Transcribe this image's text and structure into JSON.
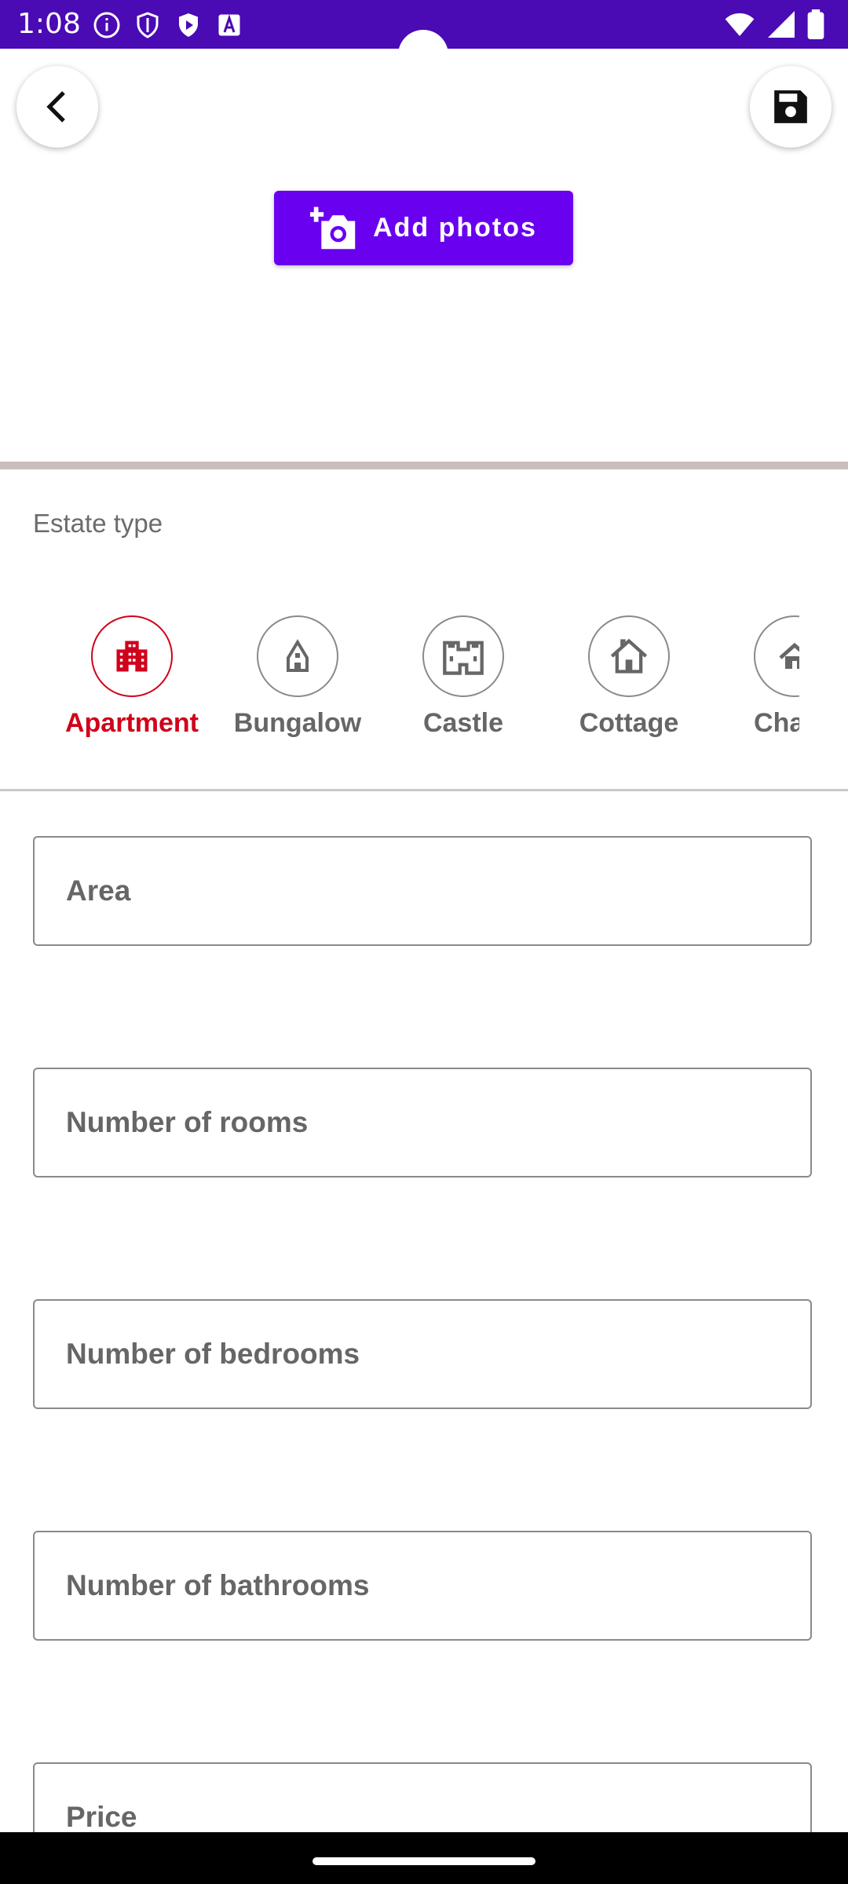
{
  "status_bar": {
    "time": "1:08"
  },
  "header": {
    "back_icon": "chevron-left-icon",
    "save_icon": "floppy-disk-icon"
  },
  "photos": {
    "add_label": "Add photos",
    "icon": "add-camera-icon"
  },
  "estate_type": {
    "label": "Estate type",
    "selected": "Apartment",
    "items": [
      {
        "label": "Apartment",
        "icon": "apartment-building-icon"
      },
      {
        "label": "Bungalow",
        "icon": "bungalow-icon"
      },
      {
        "label": "Castle",
        "icon": "castle-icon"
      },
      {
        "label": "Cottage",
        "icon": "cottage-icon"
      },
      {
        "label": "Chalet",
        "icon": "chalet-icon"
      }
    ]
  },
  "fields": {
    "area": {
      "placeholder": "Area"
    },
    "rooms": {
      "placeholder": "Number of rooms"
    },
    "bedrooms": {
      "placeholder": "Number of bedrooms"
    },
    "bathrooms": {
      "placeholder": "Number of bathrooms"
    },
    "price": {
      "placeholder": "Price"
    }
  },
  "colors": {
    "status_bar": "#4a0ab4",
    "primary": "#6a00f0",
    "selected": "#d0021b",
    "divider": "#c8bfbb"
  }
}
